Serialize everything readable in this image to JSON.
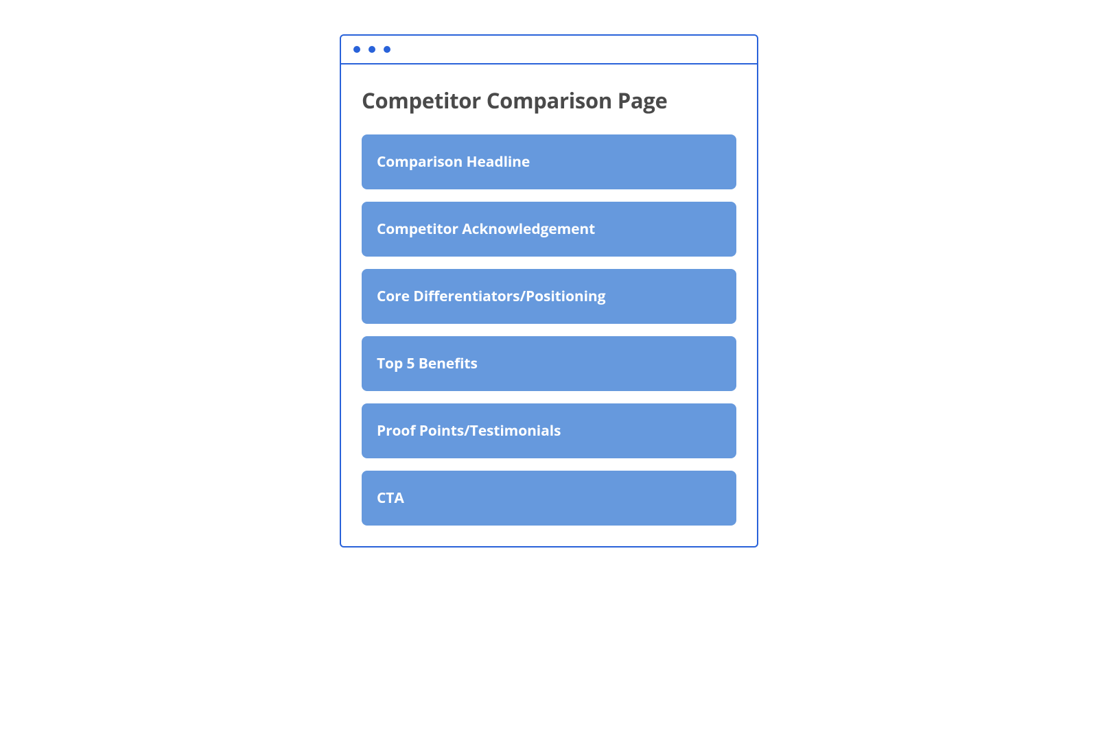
{
  "page": {
    "title": "Competitor Comparison Page"
  },
  "sections": [
    {
      "label": "Comparison Headline"
    },
    {
      "label": "Competitor Acknowledgement"
    },
    {
      "label": "Core Differentiators/Positioning"
    },
    {
      "label": "Top 5 Benefits"
    },
    {
      "label": "Proof Points/Testimonials"
    },
    {
      "label": "CTA"
    }
  ]
}
